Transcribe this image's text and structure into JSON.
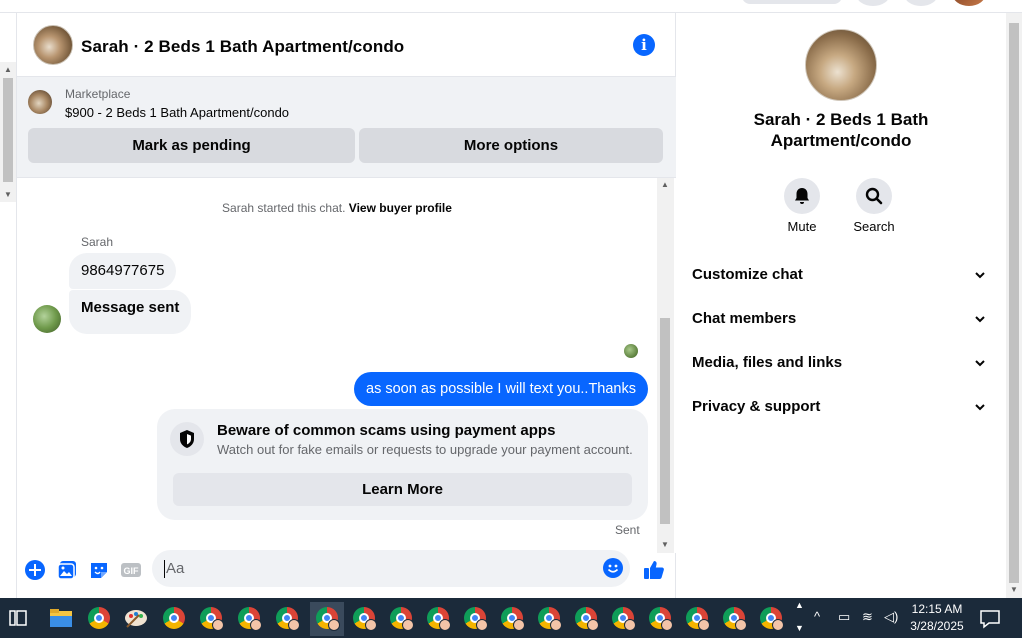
{
  "chat": {
    "title": "Sarah · 2 Beds 1 Bath Apartment/condo",
    "marketplace_label": "Marketplace",
    "marketplace_item": "$900 - 2 Beds 1 Bath Apartment/condo",
    "mark_pending_label": "Mark as pending",
    "more_options_label": "More options"
  },
  "messages": {
    "system_prefix": "Sarah started this chat.",
    "system_link": "View buyer profile",
    "sender_name": "Sarah",
    "incoming": [
      "9864977675",
      "Message sent"
    ],
    "outgoing": "as soon as possible I will text you..Thanks",
    "scam_title": "Beware of common scams using payment apps",
    "scam_desc": "Watch out for fake emails or requests to upgrade your payment account.",
    "learn_more": "Learn More",
    "status": "Sent"
  },
  "composer": {
    "placeholder": "Aa"
  },
  "sidebar": {
    "title": "Sarah · 2 Beds 1 Bath Apartment/condo",
    "mute_label": "Mute",
    "search_label": "Search",
    "sections": [
      "Customize chat",
      "Chat members",
      "Media, files and links",
      "Privacy & support"
    ]
  },
  "taskbar": {
    "time": "12:15 AM",
    "date": "3/28/2025"
  },
  "colors": {
    "accent": "#0866ff",
    "bubble_in": "#f0f2f5",
    "taskbar": "#1b2a3a"
  }
}
